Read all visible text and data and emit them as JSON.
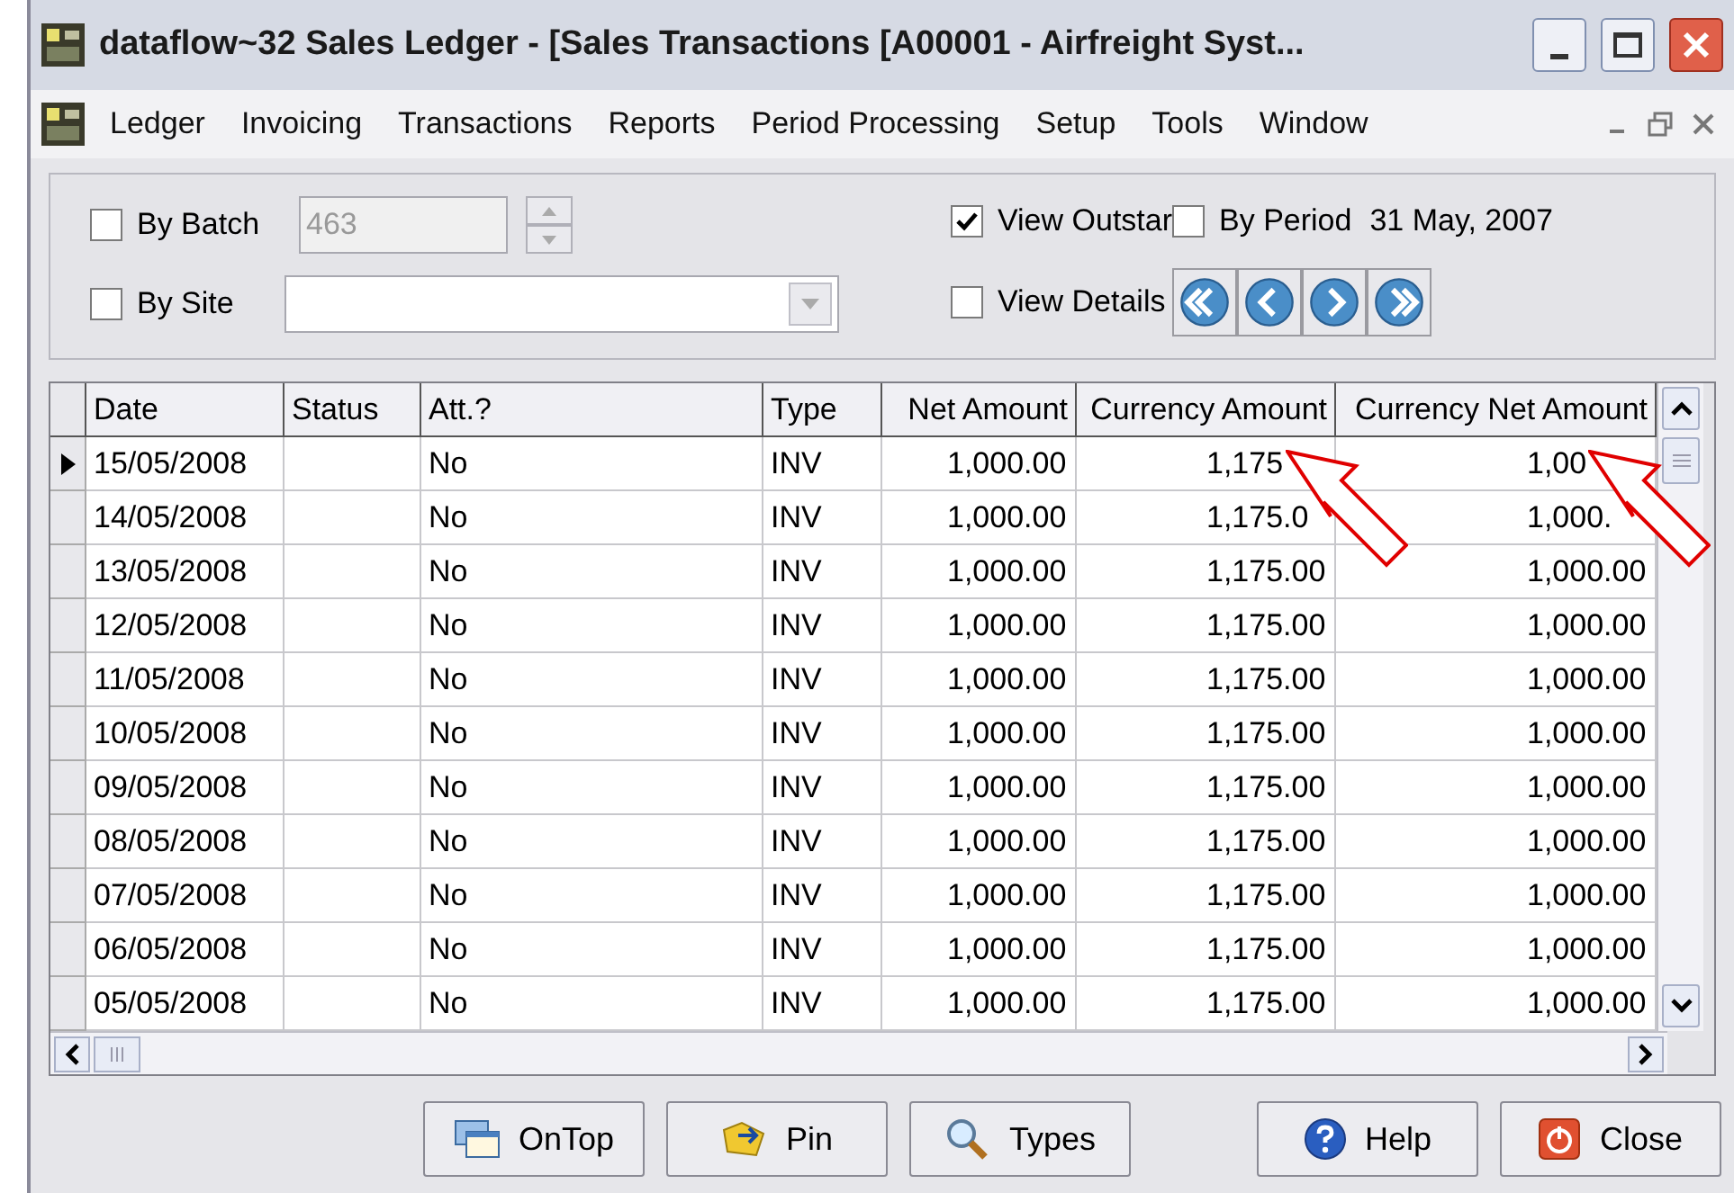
{
  "window": {
    "title": "dataflow~32 Sales Ledger - [Sales Transactions [A00001 - Airfreight Syst..."
  },
  "menu": [
    "Ledger",
    "Invoicing",
    "Transactions",
    "Reports",
    "Period Processing",
    "Setup",
    "Tools",
    "Window"
  ],
  "filters": {
    "by_batch": {
      "label": "By Batch",
      "checked": false,
      "value": "463",
      "disabled": true
    },
    "by_site": {
      "label": "By Site",
      "checked": false
    },
    "view_outstanding": {
      "label": "View Outstar",
      "checked": true
    },
    "by_period": {
      "label": "By Period",
      "checked": false,
      "date": "31 May, 2007"
    },
    "view_details": {
      "label": "View Details",
      "checked": false
    }
  },
  "table": {
    "columns": [
      {
        "label": "Date",
        "callout": false
      },
      {
        "label": "Status",
        "callout": false
      },
      {
        "label": "Att.?",
        "callout": false
      },
      {
        "label": "Type",
        "callout": false
      },
      {
        "label": "Net Amount",
        "callout": false
      },
      {
        "label": "Currency Amount",
        "callout": true
      },
      {
        "label": "Currency Net Amount",
        "callout": true
      }
    ],
    "rows": [
      {
        "selected": true,
        "cells": [
          "15/05/2008",
          "",
          "No",
          "INV",
          "1,000.00",
          "1,175",
          "1,00"
        ]
      },
      {
        "selected": false,
        "cells": [
          "14/05/2008",
          "",
          "No",
          "INV",
          "1,000.00",
          "1,175.0",
          "1,000."
        ]
      },
      {
        "selected": false,
        "cells": [
          "13/05/2008",
          "",
          "No",
          "INV",
          "1,000.00",
          "1,175.00",
          "1,000.00"
        ]
      },
      {
        "selected": false,
        "cells": [
          "12/05/2008",
          "",
          "No",
          "INV",
          "1,000.00",
          "1,175.00",
          "1,000.00"
        ]
      },
      {
        "selected": false,
        "cells": [
          "11/05/2008",
          "",
          "No",
          "INV",
          "1,000.00",
          "1,175.00",
          "1,000.00"
        ]
      },
      {
        "selected": false,
        "cells": [
          "10/05/2008",
          "",
          "No",
          "INV",
          "1,000.00",
          "1,175.00",
          "1,000.00"
        ]
      },
      {
        "selected": false,
        "cells": [
          "09/05/2008",
          "",
          "No",
          "INV",
          "1,000.00",
          "1,175.00",
          "1,000.00"
        ]
      },
      {
        "selected": false,
        "cells": [
          "08/05/2008",
          "",
          "No",
          "INV",
          "1,000.00",
          "1,175.00",
          "1,000.00"
        ]
      },
      {
        "selected": false,
        "cells": [
          "07/05/2008",
          "",
          "No",
          "INV",
          "1,000.00",
          "1,175.00",
          "1,000.00"
        ]
      },
      {
        "selected": false,
        "cells": [
          "06/05/2008",
          "",
          "No",
          "INV",
          "1,000.00",
          "1,175.00",
          "1,000.00"
        ]
      },
      {
        "selected": false,
        "cells": [
          "05/05/2008",
          "",
          "No",
          "INV",
          "1,000.00",
          "1,175.00",
          "1,000.00"
        ]
      }
    ]
  },
  "buttons": [
    {
      "label": "OnTop",
      "kind": "ontop"
    },
    {
      "label": "Pin",
      "kind": "pin"
    },
    {
      "label": "Types",
      "kind": "types"
    },
    {
      "label": "Help",
      "kind": "help"
    },
    {
      "label": "Close",
      "kind": "close"
    }
  ]
}
